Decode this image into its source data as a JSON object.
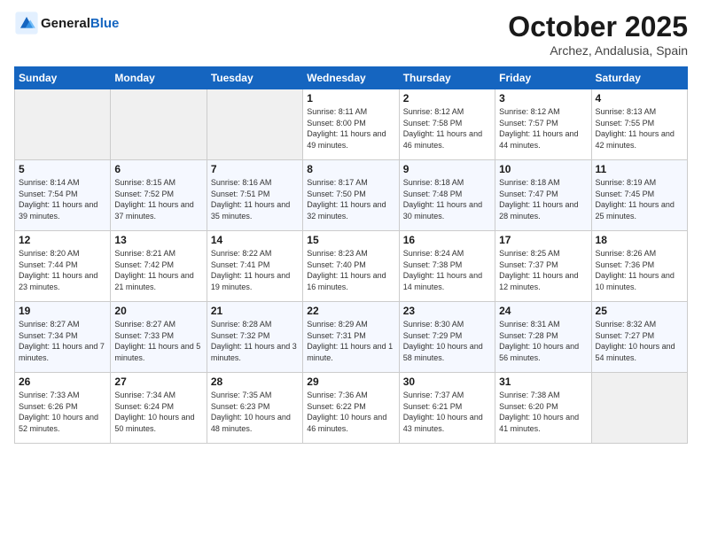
{
  "header": {
    "logo_line1": "General",
    "logo_line2": "Blue",
    "title": "October 2025",
    "subtitle": "Archez, Andalusia, Spain"
  },
  "weekdays": [
    "Sunday",
    "Monday",
    "Tuesday",
    "Wednesday",
    "Thursday",
    "Friday",
    "Saturday"
  ],
  "weeks": [
    [
      {
        "day": "",
        "info": ""
      },
      {
        "day": "",
        "info": ""
      },
      {
        "day": "",
        "info": ""
      },
      {
        "day": "1",
        "info": "Sunrise: 8:11 AM\nSunset: 8:00 PM\nDaylight: 11 hours and 49 minutes."
      },
      {
        "day": "2",
        "info": "Sunrise: 8:12 AM\nSunset: 7:58 PM\nDaylight: 11 hours and 46 minutes."
      },
      {
        "day": "3",
        "info": "Sunrise: 8:12 AM\nSunset: 7:57 PM\nDaylight: 11 hours and 44 minutes."
      },
      {
        "day": "4",
        "info": "Sunrise: 8:13 AM\nSunset: 7:55 PM\nDaylight: 11 hours and 42 minutes."
      }
    ],
    [
      {
        "day": "5",
        "info": "Sunrise: 8:14 AM\nSunset: 7:54 PM\nDaylight: 11 hours and 39 minutes."
      },
      {
        "day": "6",
        "info": "Sunrise: 8:15 AM\nSunset: 7:52 PM\nDaylight: 11 hours and 37 minutes."
      },
      {
        "day": "7",
        "info": "Sunrise: 8:16 AM\nSunset: 7:51 PM\nDaylight: 11 hours and 35 minutes."
      },
      {
        "day": "8",
        "info": "Sunrise: 8:17 AM\nSunset: 7:50 PM\nDaylight: 11 hours and 32 minutes."
      },
      {
        "day": "9",
        "info": "Sunrise: 8:18 AM\nSunset: 7:48 PM\nDaylight: 11 hours and 30 minutes."
      },
      {
        "day": "10",
        "info": "Sunrise: 8:18 AM\nSunset: 7:47 PM\nDaylight: 11 hours and 28 minutes."
      },
      {
        "day": "11",
        "info": "Sunrise: 8:19 AM\nSunset: 7:45 PM\nDaylight: 11 hours and 25 minutes."
      }
    ],
    [
      {
        "day": "12",
        "info": "Sunrise: 8:20 AM\nSunset: 7:44 PM\nDaylight: 11 hours and 23 minutes."
      },
      {
        "day": "13",
        "info": "Sunrise: 8:21 AM\nSunset: 7:42 PM\nDaylight: 11 hours and 21 minutes."
      },
      {
        "day": "14",
        "info": "Sunrise: 8:22 AM\nSunset: 7:41 PM\nDaylight: 11 hours and 19 minutes."
      },
      {
        "day": "15",
        "info": "Sunrise: 8:23 AM\nSunset: 7:40 PM\nDaylight: 11 hours and 16 minutes."
      },
      {
        "day": "16",
        "info": "Sunrise: 8:24 AM\nSunset: 7:38 PM\nDaylight: 11 hours and 14 minutes."
      },
      {
        "day": "17",
        "info": "Sunrise: 8:25 AM\nSunset: 7:37 PM\nDaylight: 11 hours and 12 minutes."
      },
      {
        "day": "18",
        "info": "Sunrise: 8:26 AM\nSunset: 7:36 PM\nDaylight: 11 hours and 10 minutes."
      }
    ],
    [
      {
        "day": "19",
        "info": "Sunrise: 8:27 AM\nSunset: 7:34 PM\nDaylight: 11 hours and 7 minutes."
      },
      {
        "day": "20",
        "info": "Sunrise: 8:27 AM\nSunset: 7:33 PM\nDaylight: 11 hours and 5 minutes."
      },
      {
        "day": "21",
        "info": "Sunrise: 8:28 AM\nSunset: 7:32 PM\nDaylight: 11 hours and 3 minutes."
      },
      {
        "day": "22",
        "info": "Sunrise: 8:29 AM\nSunset: 7:31 PM\nDaylight: 11 hours and 1 minute."
      },
      {
        "day": "23",
        "info": "Sunrise: 8:30 AM\nSunset: 7:29 PM\nDaylight: 10 hours and 58 minutes."
      },
      {
        "day": "24",
        "info": "Sunrise: 8:31 AM\nSunset: 7:28 PM\nDaylight: 10 hours and 56 minutes."
      },
      {
        "day": "25",
        "info": "Sunrise: 8:32 AM\nSunset: 7:27 PM\nDaylight: 10 hours and 54 minutes."
      }
    ],
    [
      {
        "day": "26",
        "info": "Sunrise: 7:33 AM\nSunset: 6:26 PM\nDaylight: 10 hours and 52 minutes."
      },
      {
        "day": "27",
        "info": "Sunrise: 7:34 AM\nSunset: 6:24 PM\nDaylight: 10 hours and 50 minutes."
      },
      {
        "day": "28",
        "info": "Sunrise: 7:35 AM\nSunset: 6:23 PM\nDaylight: 10 hours and 48 minutes."
      },
      {
        "day": "29",
        "info": "Sunrise: 7:36 AM\nSunset: 6:22 PM\nDaylight: 10 hours and 46 minutes."
      },
      {
        "day": "30",
        "info": "Sunrise: 7:37 AM\nSunset: 6:21 PM\nDaylight: 10 hours and 43 minutes."
      },
      {
        "day": "31",
        "info": "Sunrise: 7:38 AM\nSunset: 6:20 PM\nDaylight: 10 hours and 41 minutes."
      },
      {
        "day": "",
        "info": ""
      }
    ]
  ]
}
